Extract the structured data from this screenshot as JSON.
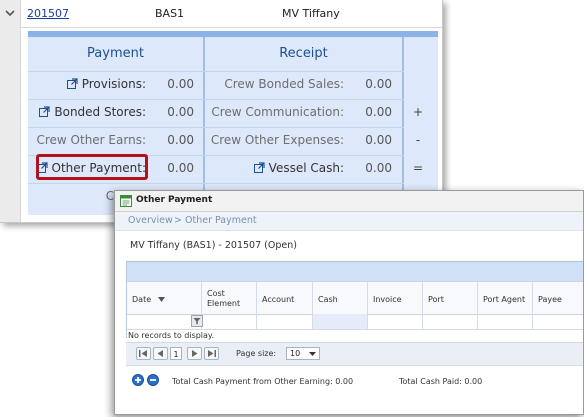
{
  "top_row": {
    "voyage_number": "201507",
    "vessel_code": "BAS1",
    "vessel_name": "MV Tiffany"
  },
  "summary": {
    "payment_title": "Payment",
    "receipt_title": "Receipt",
    "payment_rows": [
      {
        "label": "Provisions:",
        "value": "0.00"
      },
      {
        "label": "Bonded Stores:",
        "value": "0.00"
      },
      {
        "label": "Crew Other Earns:",
        "value": "0.00"
      },
      {
        "label": "Other Payment:",
        "value": "0.00"
      },
      {
        "label": "Crew",
        "value": ""
      }
    ],
    "receipt_rows": [
      {
        "label": "Crew Bonded Sales:",
        "value": "0.00",
        "op": ""
      },
      {
        "label": "Crew Communication:",
        "value": "0.00",
        "op": "+"
      },
      {
        "label": "Crew Other Expenses:",
        "value": "0.00",
        "op": "-"
      },
      {
        "label": "Vessel Cash:",
        "value": "0.00",
        "op": "="
      }
    ]
  },
  "dialog": {
    "title": "Other Payment",
    "breadcrumb_root": "Overview",
    "breadcrumb_sep": ">",
    "breadcrumb_current": "Other Payment",
    "context": "MV Tiffany (BAS1) - 201507 (Open)",
    "columns": [
      "Date",
      "Cost Element",
      "Account",
      "Cash",
      "Invoice",
      "Port",
      "Port Agent",
      "Payee"
    ],
    "no_records": "No records to display.",
    "pager": {
      "page": "1",
      "page_size_label": "Page size:",
      "page_size": "10"
    },
    "total_other_label": "Total Cash Payment from Other Earning: 0.00",
    "total_paid_label": "Total Cash Paid: 0.00"
  },
  "colors": {
    "accent": "#1d4f91",
    "panel_bg": "#dde8fa",
    "highlight_border": "#b3121d"
  }
}
